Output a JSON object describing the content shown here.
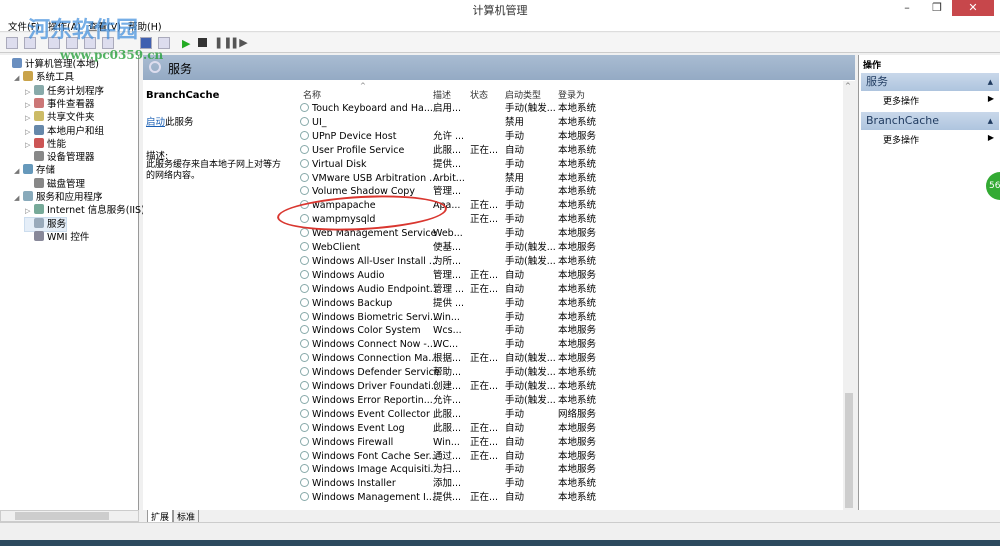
{
  "window": {
    "title": "计算机管理",
    "minimize": "–",
    "restore": "❐",
    "close": "✕"
  },
  "menu": [
    "文件(F)",
    "操作(A)",
    "查看(V)",
    "帮助(H)"
  ],
  "watermark": {
    "name": "河东软件园",
    "url": "www.pc0359.cn"
  },
  "tree": [
    {
      "label": "计算机管理(本地)",
      "level": 0,
      "tw": ""
    },
    {
      "label": "系统工具",
      "level": 1,
      "tw": "◢"
    },
    {
      "label": "任务计划程序",
      "level": 2,
      "tw": "▷"
    },
    {
      "label": "事件查看器",
      "level": 2,
      "tw": "▷"
    },
    {
      "label": "共享文件夹",
      "level": 2,
      "tw": "▷"
    },
    {
      "label": "本地用户和组",
      "level": 2,
      "tw": "▷"
    },
    {
      "label": "性能",
      "level": 2,
      "tw": "▷"
    },
    {
      "label": "设备管理器",
      "level": 2,
      "tw": ""
    },
    {
      "label": "存储",
      "level": 1,
      "tw": "◢"
    },
    {
      "label": "磁盘管理",
      "level": 2,
      "tw": ""
    },
    {
      "label": "服务和应用程序",
      "level": 1,
      "tw": "◢"
    },
    {
      "label": "Internet 信息服务(IIS)管",
      "level": 2,
      "tw": "▷"
    },
    {
      "label": "服务",
      "level": 2,
      "tw": ""
    },
    {
      "label": "WMI 控件",
      "level": 2,
      "tw": ""
    }
  ],
  "center": {
    "title": "服务",
    "selected_service": "BranchCache",
    "start_link": "启动",
    "start_suffix": "此服务",
    "desc_label": "描述:",
    "desc_text": "此服务缓存来自本地子网上对等方的网络内容。"
  },
  "columns": [
    "名称",
    "描述",
    "状态",
    "启动类型",
    "登录为"
  ],
  "services": [
    [
      "Touch Keyboard and Ha...",
      "启用...",
      "",
      "手动(触发...",
      "本地系统"
    ],
    [
      "UI_",
      "",
      "",
      "禁用",
      "本地系统"
    ],
    [
      "UPnP Device Host",
      "允许 ...",
      "",
      "手动",
      "本地服务"
    ],
    [
      "User Profile Service",
      "此服...",
      "正在...",
      "自动",
      "本地系统"
    ],
    [
      "Virtual Disk",
      "提供...",
      "",
      "手动",
      "本地系统"
    ],
    [
      "VMware USB Arbitration ...",
      "Arbit...",
      "",
      "禁用",
      "本地系统"
    ],
    [
      "Volume Shadow Copy",
      "管理...",
      "",
      "手动",
      "本地系统"
    ],
    [
      "wampapache",
      "Apa...",
      "正在...",
      "手动",
      "本地系统"
    ],
    [
      "wampmysqld",
      "",
      "正在...",
      "手动",
      "本地系统"
    ],
    [
      "Web Management Service",
      "Web...",
      "",
      "手动",
      "本地服务"
    ],
    [
      "WebClient",
      "使基...",
      "",
      "手动(触发...",
      "本地服务"
    ],
    [
      "Windows All-User Install ...",
      "为所...",
      "",
      "手动(触发...",
      "本地系统"
    ],
    [
      "Windows Audio",
      "管理...",
      "正在...",
      "自动",
      "本地服务"
    ],
    [
      "Windows Audio Endpoint...",
      "管理 ...",
      "正在...",
      "自动",
      "本地系统"
    ],
    [
      "Windows Backup",
      "提供 ...",
      "",
      "手动",
      "本地系统"
    ],
    [
      "Windows Biometric Servi...",
      "Win...",
      "",
      "手动",
      "本地系统"
    ],
    [
      "Windows Color System",
      "Wcs...",
      "",
      "手动",
      "本地服务"
    ],
    [
      "Windows Connect Now -...",
      "WC...",
      "",
      "手动",
      "本地服务"
    ],
    [
      "Windows Connection Ma...",
      "根据...",
      "正在...",
      "自动(触发...",
      "本地服务"
    ],
    [
      "Windows Defender Service",
      "帮助...",
      "",
      "手动(触发...",
      "本地系统"
    ],
    [
      "Windows Driver Foundati...",
      "创建...",
      "正在...",
      "手动(触发...",
      "本地系统"
    ],
    [
      "Windows Error Reportin...",
      "允许...",
      "",
      "手动(触发...",
      "本地系统"
    ],
    [
      "Windows Event Collector",
      "此服...",
      "",
      "手动",
      "网络服务"
    ],
    [
      "Windows Event Log",
      "此服...",
      "正在...",
      "自动",
      "本地服务"
    ],
    [
      "Windows Firewall",
      "Win...",
      "正在...",
      "自动",
      "本地服务"
    ],
    [
      "Windows Font Cache Ser...",
      "通过...",
      "正在...",
      "自动",
      "本地服务"
    ],
    [
      "Windows Image Acquisiti...",
      "为扫...",
      "",
      "手动",
      "本地服务"
    ],
    [
      "Windows Installer",
      "添加...",
      "",
      "手动",
      "本地系统"
    ],
    [
      "Windows Management I...",
      "提供...",
      "正在...",
      "自动",
      "本地系统"
    ]
  ],
  "tabs": [
    "扩展",
    "标准"
  ],
  "actions": {
    "header": "操作",
    "sections": [
      {
        "title": "服务",
        "item": "更多操作"
      },
      {
        "title": "BranchCache",
        "item": "更多操作"
      }
    ]
  },
  "badge": "56"
}
